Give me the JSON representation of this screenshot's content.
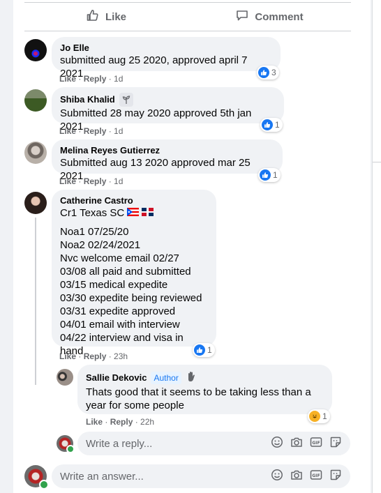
{
  "actions": {
    "like_label": "Like",
    "comment_label": "Comment"
  },
  "comments": [
    {
      "author": "Jo Elle",
      "text": "submitted aug 25 2020, approved april 7 2021",
      "like": "Like",
      "reply": "Reply",
      "time": "1d",
      "reaction_count": "3"
    },
    {
      "author": "Shiba Khalid",
      "text": "Submitted 28 may 2020 approved 5th jan 2021",
      "like": "Like",
      "reply": "Reply",
      "time": "1d",
      "reaction_count": "1"
    },
    {
      "author": "Melina Reyes Gutierrez",
      "text": "Submitted aug 13 2020 approved mar 25 2021",
      "like": "Like",
      "reply": "Reply",
      "time": "1d",
      "reaction_count": "1"
    },
    {
      "author": "Catherine Castro",
      "text": "Cr1 Texas SC",
      "lines": [
        "Noa1 07/25/20",
        "Noa2 02/24/2021",
        "Nvc welcome email 02/27",
        "03/08 all paid and submitted",
        "03/15 medical expedite",
        "03/30 expedite being reviewed",
        "03/31 expedite approved",
        "04/01 email with interview",
        "04/22 interview and visa in hand"
      ],
      "like": "Like",
      "reply": "Reply",
      "time": "23h",
      "reaction_count": "1"
    }
  ],
  "reply": {
    "author": "Sallie Dekovic",
    "badge": "Author",
    "text": "Thats good that it seems to be taking less than a year for some people",
    "like": "Like",
    "reply": "Reply",
    "time": "22h",
    "reaction_count": "1"
  },
  "reply_input": {
    "placeholder": "Write a reply..."
  },
  "answer_input": {
    "placeholder": "Write an answer..."
  },
  "colors": {
    "like_blue": "#1877f2",
    "bubble": "#f0f2f5",
    "meta": "#65676b",
    "online": "#31a24c"
  }
}
